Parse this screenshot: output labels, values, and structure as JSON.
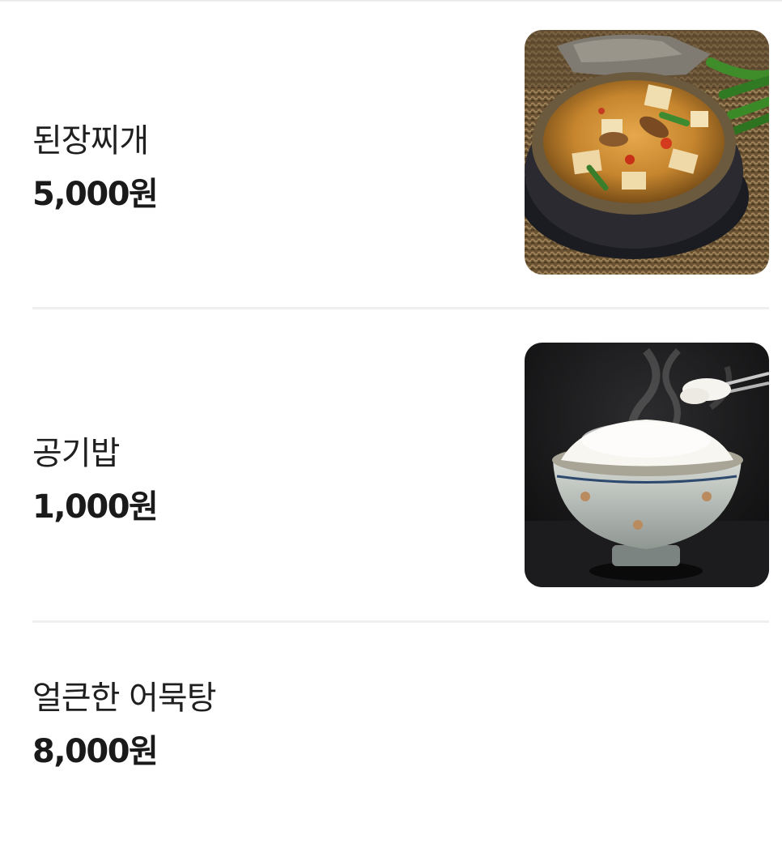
{
  "menu": {
    "items": [
      {
        "name": "된장찌개",
        "price": "5,000원",
        "image": "doenjang-jjigae-photo"
      },
      {
        "name": "공기밥",
        "price": "1,000원",
        "image": "rice-bowl-photo"
      },
      {
        "name": "얼큰한 어묵탕",
        "price": "8,000원"
      }
    ]
  }
}
